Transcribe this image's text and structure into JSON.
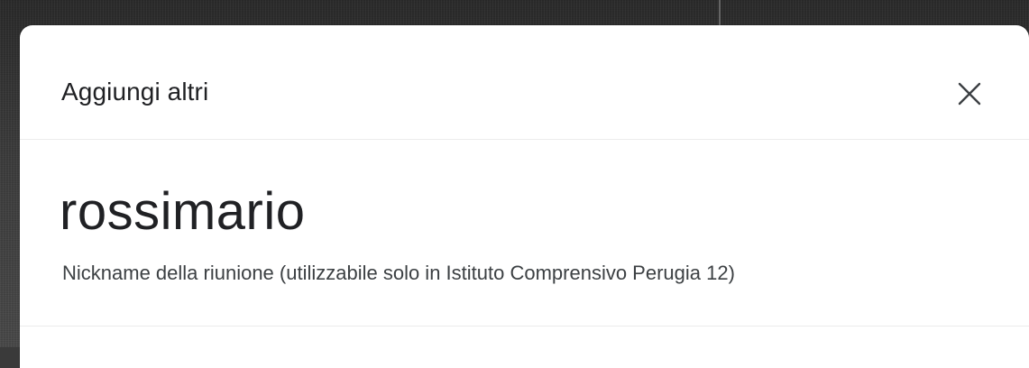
{
  "dialog": {
    "title": "Aggiungi altri",
    "close_icon": "close-icon",
    "nickname": "rossimario",
    "nickname_caption": "Nickname della riunione (utilizzabile solo in Istituto Comprensivo Perugia 12)"
  },
  "colors": {
    "dialog_background": "#ffffff",
    "primary_text": "#202124",
    "secondary_text": "#3c4043",
    "divider": "#ececec"
  }
}
